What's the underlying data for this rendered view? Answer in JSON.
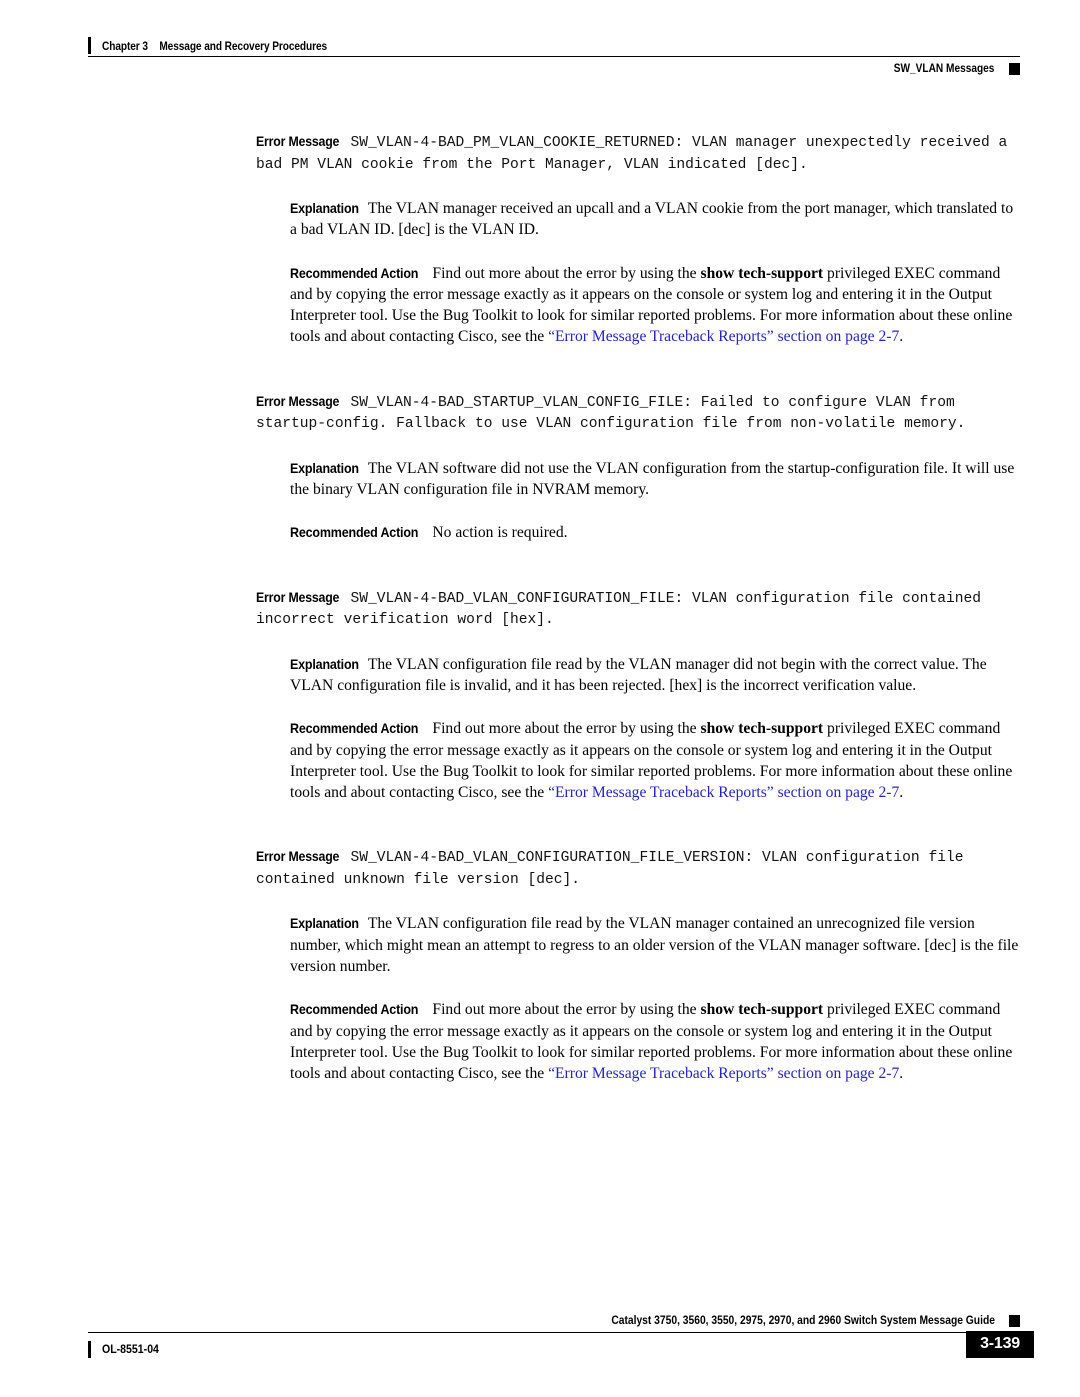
{
  "header": {
    "chapter_number": "Chapter 3",
    "chapter_title": "Message and Recovery Procedures",
    "section_title": "SW_VLAN Messages"
  },
  "footer": {
    "doc_title": "Catalyst 3750, 3560, 3550, 2975, 2970, and 2960 Switch System Message Guide",
    "doc_id": "OL-8551-04",
    "page_number": "3-139"
  },
  "labels": {
    "error_message": "Error Message",
    "explanation": "Explanation",
    "recommended_action": "Recommended Action"
  },
  "colors": {
    "link": "#2323CE",
    "text": "#000000",
    "background": "#FFFFFF"
  },
  "messages": [
    {
      "error_text": "SW_VLAN-4-BAD_PM_VLAN_COOKIE_RETURNED: VLAN manager unexpectedly received a bad PM VLAN cookie from the Port Manager, VLAN indicated [dec].",
      "explanation": "The VLAN manager received an upcall and a VLAN cookie from the port manager, which translated to a bad VLAN ID. [dec] is the VLAN ID.",
      "action_pre": "Find out more about the error by using the ",
      "action_cmd": "show tech-support",
      "action_mid": " privileged EXEC command and by copying the error message exactly as it appears on the console or system log and entering it in the Output Interpreter tool. Use the Bug Toolkit to look for similar reported problems. For more information about these online tools and about contacting Cisco, see the ",
      "action_link": "“Error Message Traceback Reports” section on page 2-7",
      "action_post": "."
    },
    {
      "error_text": "SW_VLAN-4-BAD_STARTUP_VLAN_CONFIG_FILE: Failed to configure VLAN from startup-config. Fallback to use VLAN configuration file from non-volatile memory.",
      "explanation": "The VLAN software did not use the VLAN configuration from the startup-configuration file. It will use the binary VLAN configuration file in NVRAM memory.",
      "action_pre": "No action is required.",
      "action_cmd": "",
      "action_mid": "",
      "action_link": "",
      "action_post": ""
    },
    {
      "error_text": "SW_VLAN-4-BAD_VLAN_CONFIGURATION_FILE: VLAN configuration file contained incorrect verification word [hex].",
      "explanation": "The VLAN configuration file read by the VLAN manager did not begin with the correct value. The VLAN configuration file is invalid, and it has been rejected. [hex] is the incorrect verification value.",
      "action_pre": "Find out more about the error by using the ",
      "action_cmd": "show tech-support",
      "action_mid": " privileged EXEC command and by copying the error message exactly as it appears on the console or system log and entering it in the Output Interpreter tool. Use the Bug Toolkit to look for similar reported problems. For more information about these online tools and about contacting Cisco, see the ",
      "action_link": "“Error Message Traceback Reports” section on page 2-7",
      "action_post": "."
    },
    {
      "error_text": "SW_VLAN-4-BAD_VLAN_CONFIGURATION_FILE_VERSION: VLAN configuration file contained unknown file version [dec].",
      "explanation": "The VLAN configuration file read by the VLAN manager contained an unrecognized file version number, which might mean an attempt to regress to an older version of the VLAN manager software. [dec] is the file version number.",
      "action_pre": "Find out more about the error by using the ",
      "action_cmd": "show tech-support",
      "action_mid": " privileged EXEC command and by copying the error message exactly as it appears on the console or system log and entering it in the Output Interpreter tool. Use the Bug Toolkit to look for similar reported problems. For more information about these online tools and about contacting Cisco, see the ",
      "action_link": "“Error Message Traceback Reports” section on page 2-7",
      "action_post": "."
    }
  ]
}
